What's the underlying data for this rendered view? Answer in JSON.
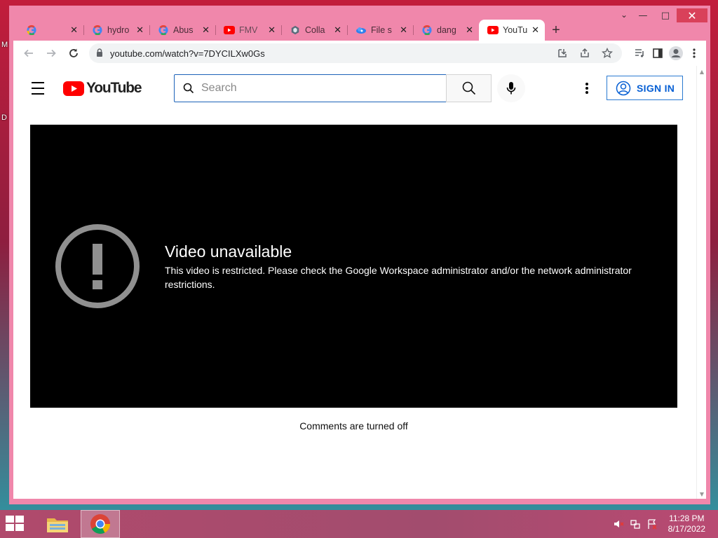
{
  "desktop": {
    "labels": [
      "M",
      "D"
    ]
  },
  "window": {
    "controls": {
      "minimize": "—",
      "maximize": "□",
      "close": "✕"
    },
    "tabs": [
      {
        "title": "",
        "favicon": "google-icon"
      },
      {
        "title": "hydro",
        "favicon": "google-icon"
      },
      {
        "title": "Abus",
        "favicon": "google-icon"
      },
      {
        "title": "FMV ",
        "favicon": "youtube-icon"
      },
      {
        "title": "Colla",
        "favicon": "collab-icon"
      },
      {
        "title": "File s",
        "favicon": "cloud-icon"
      },
      {
        "title": "dang",
        "favicon": "google-icon"
      },
      {
        "title": "YouTu",
        "favicon": "youtube-icon",
        "active": true
      }
    ],
    "tab_close_glyph": "✕",
    "new_tab_glyph": "+",
    "tab_search_glyph": "⌄"
  },
  "toolbar": {
    "url": "youtube.com/watch?v=7DYCILXw0Gs"
  },
  "youtube": {
    "logo_text": "YouTube",
    "search": {
      "placeholder": "Search",
      "value": ""
    },
    "sign_in": "SIGN IN",
    "player": {
      "error_title": "Video unavailable",
      "error_message": "This video is restricted. Please check the Google Workspace administrator and/or the network administrator restrictions."
    },
    "comments_status": "Comments are turned off"
  },
  "taskbar": {
    "time": "11:28 PM",
    "date": "8/17/2022"
  },
  "colors": {
    "frame": "#f087ab",
    "yt_red": "#ff0000",
    "signin_blue": "#065fd4",
    "player_bg": "#000000"
  }
}
